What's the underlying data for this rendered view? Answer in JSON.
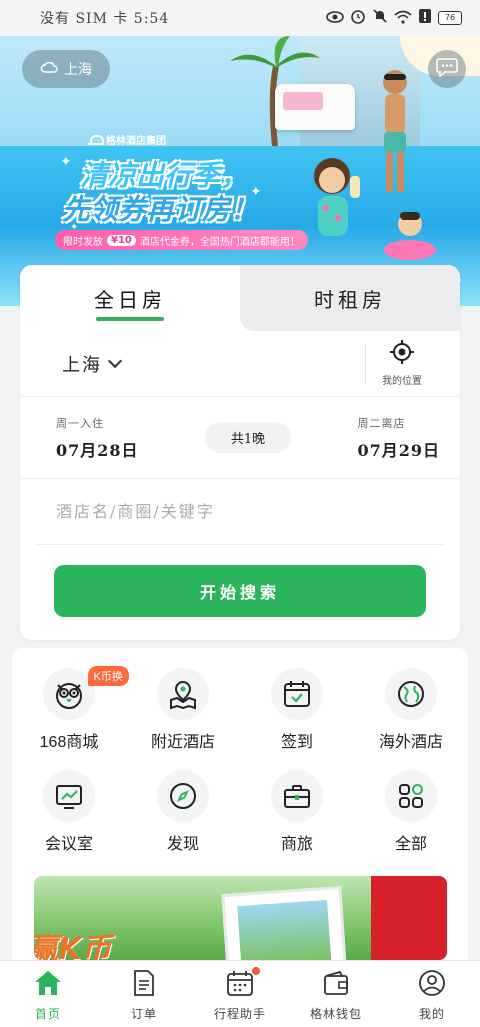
{
  "status_bar": {
    "left_text": "没有 SIM 卡 5:54",
    "battery": "76"
  },
  "banner": {
    "city": "上海",
    "logo_text": "格林酒店集团",
    "headline_line1": "清凉出行季，",
    "headline_line2": "先领券再订房！",
    "promo_prefix": "限时发放",
    "promo_amount": "¥10",
    "promo_suffix": "酒店代金券，全国热门酒店都能用！"
  },
  "search": {
    "tabs": [
      {
        "label": "全日房",
        "active": true
      },
      {
        "label": "时租房",
        "active": false
      }
    ],
    "city": "上海",
    "location_label": "我的位置",
    "checkin_label": "周一入住",
    "checkin_date": "07月28日",
    "nights": "共1晚",
    "checkout_label": "周二离店",
    "checkout_date": "07月29日",
    "keyword_placeholder": "酒店名/商圈/关键字",
    "search_button": "开始搜索"
  },
  "grid": {
    "items": [
      {
        "label": "168商城",
        "icon": "owl-icon",
        "badge": "K币换"
      },
      {
        "label": "附近酒店",
        "icon": "map-pin-icon"
      },
      {
        "label": "签到",
        "icon": "calendar-check-icon"
      },
      {
        "label": "海外酒店",
        "icon": "globe-icon"
      },
      {
        "label": "会议室",
        "icon": "chart-board-icon"
      },
      {
        "label": "发现",
        "icon": "compass-icon"
      },
      {
        "label": "商旅",
        "icon": "briefcase-icon"
      },
      {
        "label": "全部",
        "icon": "apps-icon"
      }
    ]
  },
  "promo2": {
    "text": "赢K币"
  },
  "bottom_nav": {
    "items": [
      {
        "label": "首页",
        "active": true
      },
      {
        "label": "订单"
      },
      {
        "label": "行程助手",
        "dot": true
      },
      {
        "label": "格林钱包"
      },
      {
        "label": "我的"
      }
    ]
  },
  "colors": {
    "accent": "#2cb35e",
    "badge": "#ff6a3d",
    "promo_pink": "#ff5fa8"
  }
}
